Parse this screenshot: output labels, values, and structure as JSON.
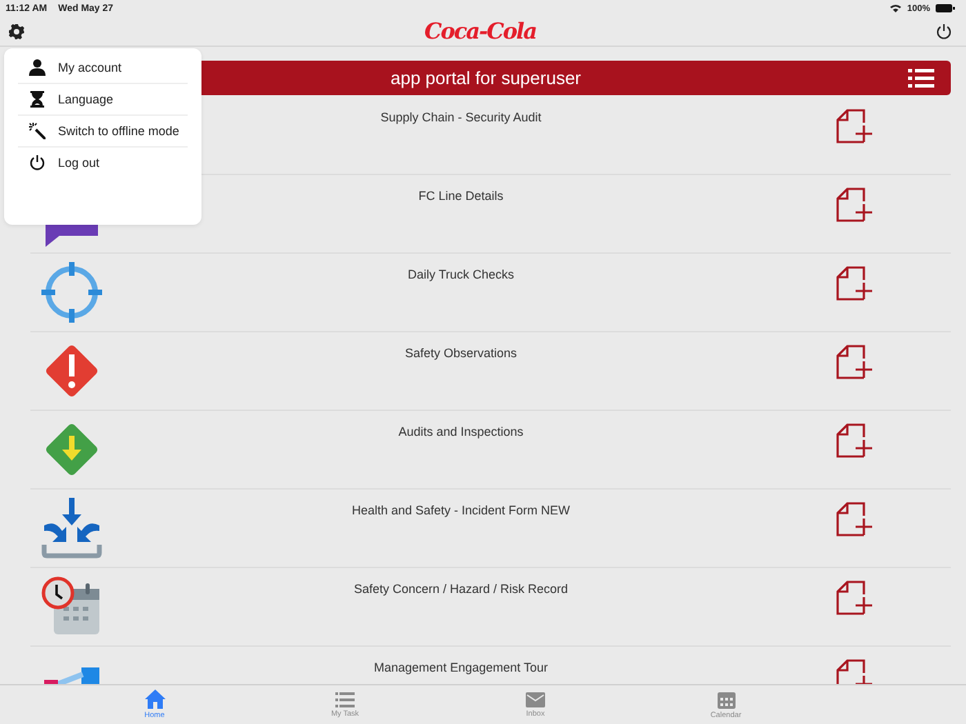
{
  "status_bar": {
    "time": "11:12 AM",
    "date": "Wed May 27",
    "battery": "100%"
  },
  "header": {
    "logo": "Coca-Cola"
  },
  "banner": {
    "title": "app portal for superuser"
  },
  "rows": [
    {
      "title": "Supply Chain - Security Audit"
    },
    {
      "title": "FC Line Details"
    },
    {
      "title": "Daily Truck Checks"
    },
    {
      "title": "Safety Observations"
    },
    {
      "title": "Audits and Inspections"
    },
    {
      "title": "Health and Safety - Incident Form NEW"
    },
    {
      "title": "Safety Concern / Hazard / Risk Record"
    },
    {
      "title": "Management Engagement Tour"
    }
  ],
  "menu": {
    "items": [
      {
        "label": "My account"
      },
      {
        "label": "Language"
      },
      {
        "label": "Switch to offline mode"
      },
      {
        "label": "Log out"
      }
    ]
  },
  "tabs": [
    {
      "label": "Home",
      "selected": true
    },
    {
      "label": "My Task",
      "selected": false
    },
    {
      "label": "Inbox",
      "selected": false
    },
    {
      "label": "Calendar",
      "selected": false
    }
  ]
}
